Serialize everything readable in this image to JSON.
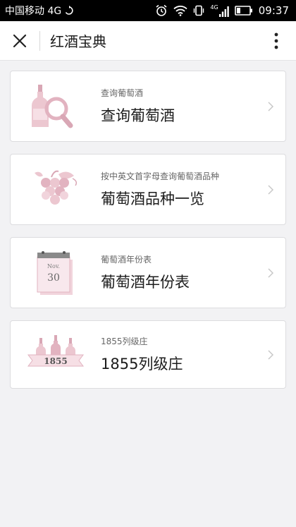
{
  "status_bar": {
    "carrier": "中国移动 4G",
    "network": "4G",
    "time": "09:37",
    "icons": [
      "sync-icon",
      "alarm-icon",
      "wifi-icon",
      "vibrate-icon",
      "signal-icon",
      "battery-icon"
    ]
  },
  "header": {
    "title": "红酒宝典",
    "close_icon": "close-icon",
    "more_icon": "more-vertical-icon"
  },
  "items": [
    {
      "subtitle": "查询葡萄酒",
      "title": "查询葡萄酒",
      "icon": "wine-bottle-search-icon"
    },
    {
      "subtitle": "按中英文首字母查询葡萄酒品种",
      "title": "葡萄酒品种一览",
      "icon": "grape-icon"
    },
    {
      "subtitle": "葡萄酒年份表",
      "title": "葡萄酒年份表",
      "icon": "calendar-icon",
      "icon_text": {
        "month": "Nov.",
        "day": "30"
      }
    },
    {
      "subtitle": "1855列级庄",
      "title": "1855列级庄",
      "icon": "wine-bottles-banner-icon",
      "icon_text": {
        "year": "1855"
      }
    }
  ],
  "colors": {
    "status_bg": "#000000",
    "page_bg": "#f2f2f4",
    "icon_pink": "#ecc7d0",
    "icon_pink_dark": "#d9a7b5"
  }
}
